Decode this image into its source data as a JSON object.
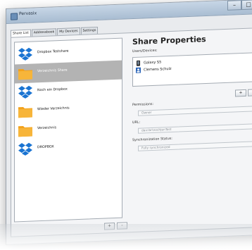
{
  "window": {
    "title": "Pervasix",
    "close_glyph": "✕",
    "min_glyph": "–",
    "max_glyph": "□"
  },
  "tabs": [
    {
      "label": "Share List",
      "active": true
    },
    {
      "label": "Addressbook",
      "active": false
    },
    {
      "label": "My Devices",
      "active": false
    },
    {
      "label": "Settings",
      "active": false
    }
  ],
  "shares": [
    {
      "label": "Dropbox Testshare",
      "icon": "dropbox-icon",
      "selected": false
    },
    {
      "label": "Verzeichnis Share",
      "icon": "folder-icon",
      "selected": true
    },
    {
      "label": "Noch ein Dropbox",
      "icon": "dropbox-icon",
      "selected": false
    },
    {
      "label": "Wieder Verzeichnis",
      "icon": "folder-icon",
      "selected": false
    },
    {
      "label": "Verzeichnis",
      "icon": "folder-icon",
      "selected": false
    },
    {
      "label": "DROPBOX",
      "icon": "dropbox-icon",
      "selected": false
    }
  ],
  "list_buttons": {
    "add": "+",
    "remove": "-"
  },
  "properties": {
    "title": "Share Properties",
    "devices_label": "Users/Devices:",
    "devices": [
      {
        "label": "Galaxy S5",
        "icon": "phone-icon"
      },
      {
        "label": "Clemens Schulz",
        "icon": "contact-icon"
      }
    ],
    "add": "+",
    "remove": "-",
    "permissions_label": "Permissions:",
    "permissions_value": "Owner",
    "url_label": "URL:",
    "url_value": "dav:lar\\nochjenTest",
    "sync_label": "Synchronization Status:",
    "sync_value": "Fully synchronized"
  },
  "colors": {
    "folder": "#f3a21b",
    "dropbox": "#1a74d2",
    "selected_row": "#b3b3b3"
  }
}
